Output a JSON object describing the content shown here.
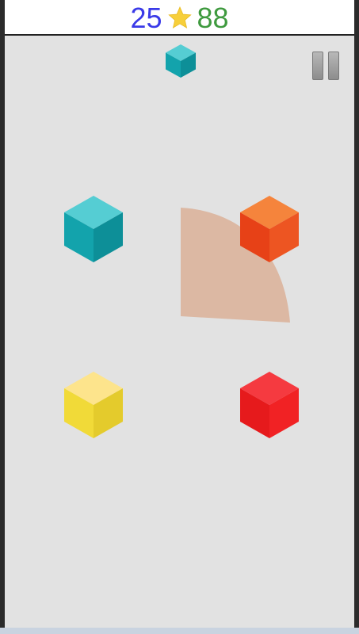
{
  "score": {
    "current": "25",
    "best": "88",
    "icon": "star-icon",
    "current_color": "#3a3ae8",
    "best_color": "#3f9a3f",
    "star_color": "#f7cf3a"
  },
  "controls": {
    "pause_icon": "pause-icon"
  },
  "next_cube": {
    "color": "teal",
    "colors": {
      "top": "#55cdd3",
      "left": "#13a3ac",
      "right": "#0d8f98"
    }
  },
  "cubes": [
    {
      "id": "top-left",
      "color": "teal",
      "colors": {
        "top": "#55cdd3",
        "left": "#13a3ac",
        "right": "#0d8f98"
      }
    },
    {
      "id": "top-right",
      "color": "orange",
      "colors": {
        "top": "#f5843c",
        "left": "#e74117",
        "right": "#ed5522"
      }
    },
    {
      "id": "bottom-left",
      "color": "yellow",
      "colors": {
        "top": "#fde48c",
        "left": "#f1da38",
        "right": "#e4cb2c"
      }
    },
    {
      "id": "bottom-right",
      "color": "red",
      "colors": {
        "top": "#f53a40",
        "left": "#e61a1c",
        "right": "#f12224"
      }
    }
  ],
  "pointer": {
    "color": "#dcb8a3",
    "direction": "top-right"
  },
  "background": "#e2e2e2"
}
